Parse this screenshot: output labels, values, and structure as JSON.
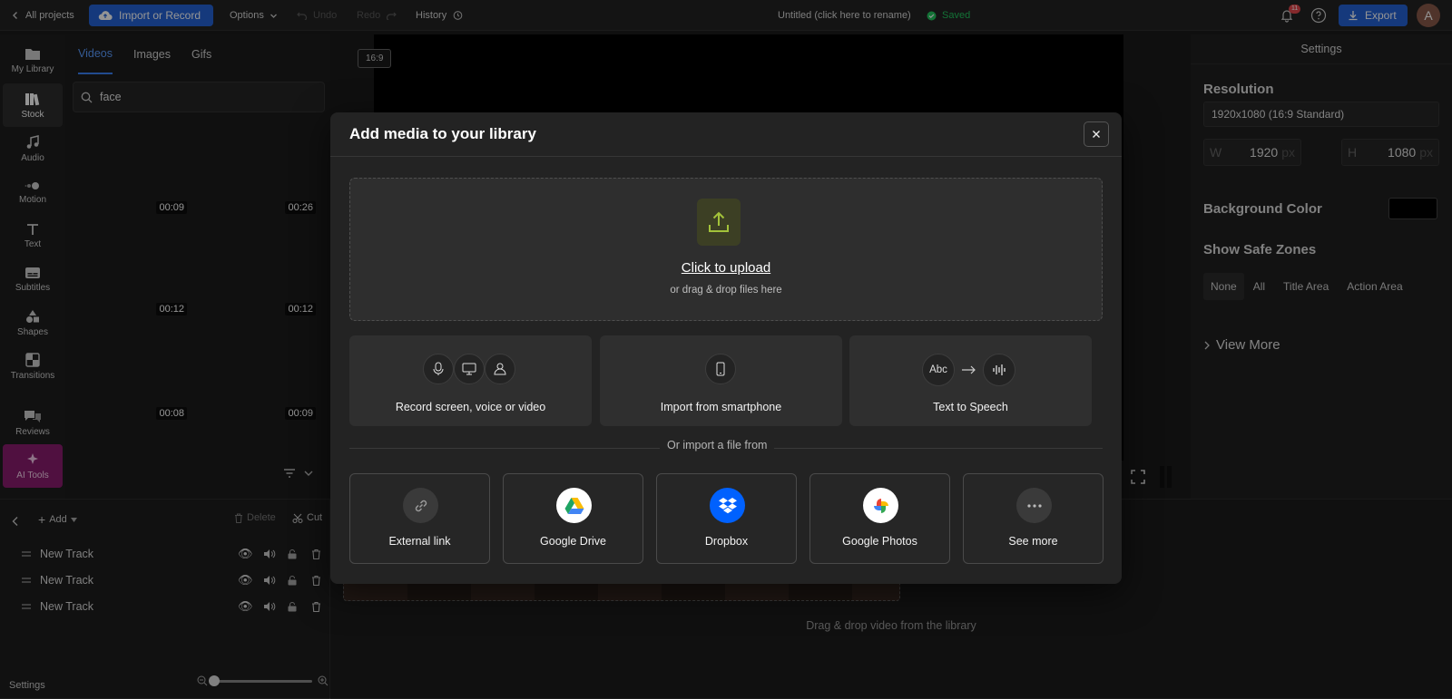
{
  "topbar": {
    "all_projects": "All projects",
    "import_record": "Import or Record",
    "options": "Options",
    "undo": "Undo",
    "redo": "Redo",
    "history": "History",
    "project_title": "Untitled (click here to rename)",
    "saved": "Saved",
    "notif_count": "11",
    "export": "Export",
    "avatar_letter": "A"
  },
  "nav": {
    "my_library": "My Library",
    "stock": "Stock",
    "audio": "Audio",
    "motion": "Motion",
    "text": "Text",
    "subtitles": "Subtitles",
    "shapes": "Shapes",
    "transitions": "Transitions",
    "reviews": "Reviews",
    "ai_tools": "AI Tools"
  },
  "library": {
    "tabs": [
      "Videos",
      "Images",
      "Gifs"
    ],
    "search_value": "face",
    "durations": [
      "00:09",
      "00:26",
      "00:12",
      "00:12",
      "00:08",
      "00:09"
    ]
  },
  "stage": {
    "aspect": "16:9",
    "drag_drop": "Drag & drop video from the library"
  },
  "settings": {
    "title": "Settings",
    "resolution_label": "Resolution",
    "resolution_value": "1920x1080 (16:9 Standard)",
    "w_label": "W",
    "w_value": "1920",
    "h_label": "H",
    "h_value": "1080",
    "unit": "px",
    "bg_color_label": "Background Color",
    "bg_color": "#000000",
    "safe_zones_label": "Show Safe Zones",
    "safe_zones": [
      "None",
      "All",
      "Title Area",
      "Action Area"
    ],
    "view_more": "View More"
  },
  "timeline": {
    "add": "Add",
    "delete": "Delete",
    "cut": "Cut",
    "tracks": [
      "New Track",
      "New Track",
      "New Track"
    ],
    "settings": "Settings"
  },
  "modal": {
    "title": "Add media to your library",
    "upload": "Click to upload",
    "drag_drop": "or drag & drop files here",
    "record": "Record screen, voice or video",
    "smartphone": "Import from smartphone",
    "tts": "Text to Speech",
    "tts_abc": "Abc",
    "or_import": "Or import a file from",
    "sources": [
      "External link",
      "Google Drive",
      "Dropbox",
      "Google Photos",
      "See more"
    ]
  },
  "colors": {
    "accent": "#2563d6",
    "ai_tools": "#8b1d6f",
    "saved_green": "#22c55e",
    "upload_icon": "#a3c23a"
  }
}
